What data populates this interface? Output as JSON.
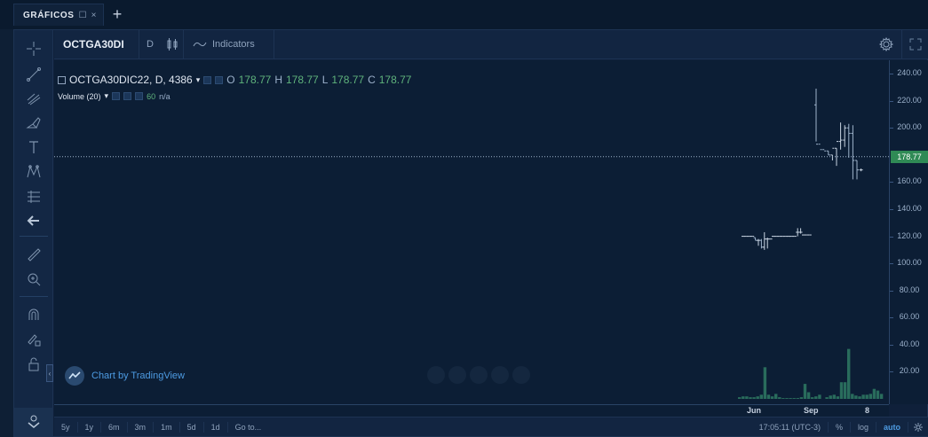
{
  "tabs": {
    "active_label": "GRÁFICOS",
    "new_tab_label": "+"
  },
  "toolbar": {
    "symbol": "OCTGA30DI",
    "interval": "D",
    "indicators_label": "Indicators"
  },
  "legend": {
    "symbol_full": "OCTGA30DIC22, D, 4386",
    "open_label": "O",
    "open_value": "178.77",
    "high_label": "H",
    "high_value": "178.77",
    "low_label": "L",
    "low_value": "178.77",
    "close_label": "C",
    "close_value": "178.77",
    "volume_label": "Volume (20)",
    "volume_value": "60",
    "volume_extra": "n/a"
  },
  "branding": {
    "text": "Chart by TradingView"
  },
  "price_axis": {
    "labels": [
      "240.00",
      "220.00",
      "200.00",
      "160.00",
      "140.00",
      "120.00",
      "100.00",
      "80.00",
      "60.00",
      "40.00",
      "20.00"
    ],
    "current_price": "178.77"
  },
  "time_axis": {
    "labels": [
      "Jun",
      "Sep",
      "8"
    ]
  },
  "bottom_bar": {
    "ranges": [
      "5y",
      "1y",
      "6m",
      "3m",
      "1m",
      "5d",
      "1d"
    ],
    "goto_label": "Go to...",
    "clock": "17:05:11 (UTC-3)",
    "percent_label": "%",
    "log_label": "log",
    "auto_label": "auto"
  },
  "colors": {
    "background": "#0c1e35",
    "up": "#5fb37c",
    "volume": "#2f7a63",
    "price_line": "#9fb4cc",
    "current_price_badge": "#2f8a55",
    "accent": "#4d9be2"
  },
  "icons": {
    "left_toolbar": [
      "crosshair-icon",
      "trend-line-icon",
      "pitchfork-icon",
      "brush-icon",
      "text-icon",
      "pattern-icon",
      "fib-icon",
      "back-arrow-icon",
      "ruler-icon",
      "zoom-in-icon",
      "magnet-icon",
      "lock-pencil-icon",
      "lock-icon",
      "eye-icon"
    ]
  },
  "chart_data": {
    "type": "ohlc",
    "x": [
      "May-23",
      "May-24",
      "May-25",
      "May-26",
      "May-27",
      "May-30",
      "May-31",
      "Jun-01",
      "Jun-02",
      "Jun-03",
      "Jun-06",
      "Jun-07",
      "Jun-08",
      "Jun-09",
      "Jun-10",
      "Jun-13",
      "Jun-14",
      "Jun-15",
      "Jun-16",
      "Jun-17",
      "Jun-20",
      "Jun-21",
      "Jun-22",
      "Aug-24",
      "Aug-25",
      "Aug-26",
      "Aug-29",
      "Aug-30",
      "Aug-31",
      "Sep-01",
      "Sep-02",
      "Sep-05",
      "Sep-06",
      "Sep-07",
      "Sep-08"
    ],
    "series": [
      {
        "name": "OHLC",
        "open": [
          120,
          120,
          120,
          120,
          119,
          117,
          117,
          112,
          118,
          118,
          120,
          120,
          120,
          120,
          120,
          120,
          120,
          120,
          123,
          123,
          121,
          121,
          121,
          217,
          188,
          184,
          183,
          180,
          185,
          190,
          191,
          200,
          196,
          176,
          169
        ],
        "high": [
          120,
          120,
          120,
          120,
          119,
          118,
          118,
          123,
          119,
          118,
          120,
          120,
          120,
          120,
          120,
          120,
          120,
          120,
          126,
          126,
          121,
          121,
          121,
          229,
          188,
          184,
          183,
          180,
          185,
          204,
          202,
          203,
          202,
          176,
          170
        ],
        "low": [
          120,
          120,
          120,
          120,
          117,
          113,
          111,
          110,
          111,
          118,
          120,
          120,
          120,
          120,
          120,
          120,
          120,
          120,
          120,
          122,
          121,
          121,
          121,
          190,
          188,
          184,
          180,
          176,
          172,
          184,
          186,
          178,
          162,
          162,
          168
        ],
        "close": [
          120,
          120,
          120,
          120,
          117,
          117,
          112,
          118,
          118,
          118,
          120,
          120,
          120,
          120,
          120,
          120,
          120,
          120,
          123,
          123,
          121,
          121,
          121,
          188,
          184,
          183,
          180,
          185,
          190,
          191,
          200,
          196,
          176,
          169,
          169
        ]
      },
      {
        "name": "Volume (20)",
        "values": [
          2,
          3,
          3,
          2,
          2,
          3,
          5,
          38,
          5,
          3,
          6,
          2,
          1,
          1,
          1,
          1,
          1,
          2,
          18,
          8,
          2,
          3,
          5,
          0,
          2,
          4,
          5,
          3,
          20,
          20,
          60,
          6,
          4,
          3,
          5,
          5,
          6,
          12,
          10,
          6
        ]
      }
    ],
    "ylim": [
      0,
      246
    ],
    "current_price": 178.77
  }
}
